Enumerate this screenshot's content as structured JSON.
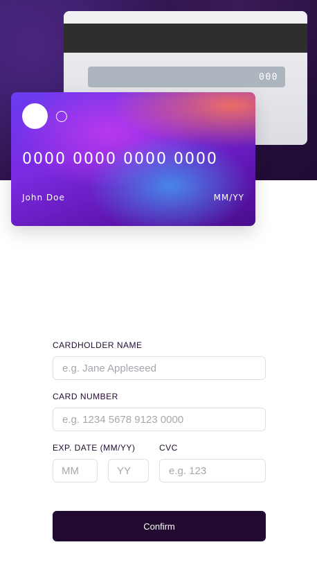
{
  "card_back": {
    "cvc": "000"
  },
  "card_front": {
    "number": "0000 0000 0000 0000",
    "holder": "John Doe",
    "expiry": "MM/YY"
  },
  "form": {
    "cardholder_label": "CARDHOLDER NAME",
    "cardholder_placeholder": "e.g. Jane Appleseed",
    "card_number_label": "CARD NUMBER",
    "card_number_placeholder": "e.g. 1234 5678 9123 0000",
    "exp_label": "EXP. DATE (MM/YY)",
    "exp_month_placeholder": "MM",
    "exp_year_placeholder": "YY",
    "cvc_label": "CVC",
    "cvc_placeholder": "e.g. 123",
    "confirm_label": "Confirm"
  },
  "colors": {
    "dark_violet": "#21092f",
    "input_border": "#dfdee0",
    "placeholder": "#a8a6ad"
  }
}
